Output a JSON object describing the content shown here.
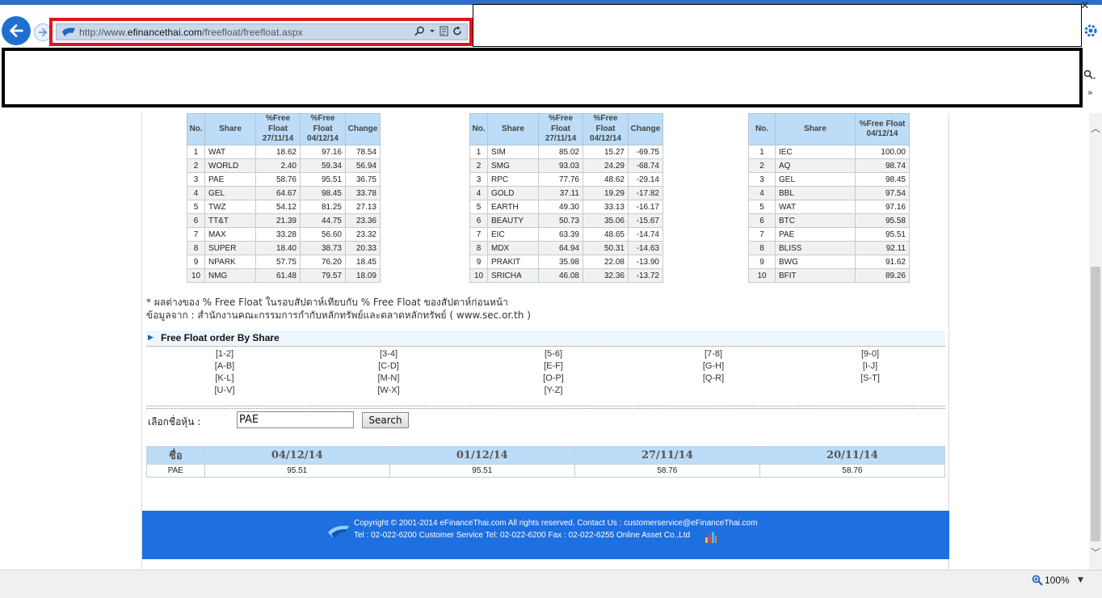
{
  "browser": {
    "url_prefix": "http://www.",
    "url_domain": "efinancethai.com",
    "url_path": "/freefloat/freefloat.aspx",
    "zoom_level": "100%"
  },
  "tables": {
    "increase": {
      "headers": [
        "No.",
        "Share",
        "%Free Float 27/11/14",
        "%Free Float 04/12/14",
        "Change"
      ],
      "rows": [
        [
          "1",
          "WAT",
          "18.62",
          "97.16",
          "78.54"
        ],
        [
          "2",
          "WORLD",
          "2.40",
          "59.34",
          "56.94"
        ],
        [
          "3",
          "PAE",
          "58.76",
          "95.51",
          "36.75"
        ],
        [
          "4",
          "GEL",
          "64.67",
          "98.45",
          "33.78"
        ],
        [
          "5",
          "TWZ",
          "54.12",
          "81.25",
          "27.13"
        ],
        [
          "6",
          "TT&T",
          "21.39",
          "44.75",
          "23.36"
        ],
        [
          "7",
          "MAX",
          "33.28",
          "56.60",
          "23.32"
        ],
        [
          "8",
          "SUPER",
          "18.40",
          "38.73",
          "20.33"
        ],
        [
          "9",
          "NPARK",
          "57.75",
          "76.20",
          "18.45"
        ],
        [
          "10",
          "NMG",
          "61.48",
          "79.57",
          "18.09"
        ]
      ]
    },
    "decrease": {
      "headers": [
        "No.",
        "Share",
        "%Free Float 27/11/14",
        "%Free Float 04/12/14",
        "Change"
      ],
      "rows": [
        [
          "1",
          "SIM",
          "85.02",
          "15.27",
          "-69.75"
        ],
        [
          "2",
          "SMG",
          "93.03",
          "24.29",
          "-68.74"
        ],
        [
          "3",
          "RPC",
          "77.76",
          "48.62",
          "-29.14"
        ],
        [
          "4",
          "GOLD",
          "37.11",
          "19.29",
          "-17.82"
        ],
        [
          "5",
          "EARTH",
          "49.30",
          "33.13",
          "-16.17"
        ],
        [
          "6",
          "BEAUTY",
          "50.73",
          "35.06",
          "-15.67"
        ],
        [
          "7",
          "EIC",
          "63.39",
          "48.65",
          "-14.74"
        ],
        [
          "8",
          "MDX",
          "64.94",
          "50.31",
          "-14.63"
        ],
        [
          "9",
          "PRAKIT",
          "35.98",
          "22.08",
          "-13.90"
        ],
        [
          "10",
          "SRICHA",
          "46.08",
          "32.36",
          "-13.72"
        ]
      ]
    },
    "top": {
      "headers": [
        "No.",
        "Share",
        "%Free Float 04/12/14"
      ],
      "rows": [
        [
          "1",
          "IEC",
          "100.00"
        ],
        [
          "2",
          "AQ",
          "98.74"
        ],
        [
          "3",
          "GEL",
          "98.45"
        ],
        [
          "4",
          "BBL",
          "97.54"
        ],
        [
          "5",
          "WAT",
          "97.16"
        ],
        [
          "6",
          "BTC",
          "95.58"
        ],
        [
          "7",
          "PAE",
          "95.51"
        ],
        [
          "8",
          "BLISS",
          "92.11"
        ],
        [
          "9",
          "BWG",
          "91.62"
        ],
        [
          "10",
          "BFIT",
          "89.26"
        ]
      ]
    }
  },
  "notes": {
    "line1": "* ผลต่างของ % Free Float ในรอบสัปดาห์เทียบกับ % Free Float ของสัปดาห์ก่อนหน้า",
    "line2": "ข้อมูลจาก : สำนักงานคณะกรรมการกำกับหลักทรัพย์และตลาดหลักทรัพย์ ( www.sec.or.th )"
  },
  "order": {
    "title": "Free Float order By Share",
    "letters": [
      "[1-2]",
      "[3-4]",
      "[5-6]",
      "[7-8]",
      "[9-0]",
      "[A-B]",
      "[C-D]",
      "[E-F]",
      "[G-H]",
      "[I-J]",
      "[K-L]",
      "[M-N]",
      "[O-P]",
      "[Q-R]",
      "[S-T]",
      "[U-V]",
      "[W-X]",
      "[Y-Z]"
    ]
  },
  "search": {
    "label": "เลือกชื่อหุ้น :",
    "value": "PAE",
    "button": "Search"
  },
  "history": {
    "headers": [
      "ชื่อ",
      "04/12/14",
      "01/12/14",
      "27/11/14",
      "20/11/14"
    ],
    "row": [
      "PAE",
      "95.51",
      "95.51",
      "58.76",
      "58.76"
    ]
  },
  "footer": {
    "line1": "Copyright © 2001-2014 eFinanceThai.com All rights reserved. Contact Us : customerservice@eFinanceThai.com",
    "line2": "Tel : 02-022-6200  Customer Service Tel: 02-022-6200  Fax : 02-022-6255   Online Asset Co.,Ltd"
  },
  "colors": {
    "header_blue": "#bcdcf7",
    "footer_blue": "#1e6fe0",
    "highlight_red": "#e0141c"
  }
}
